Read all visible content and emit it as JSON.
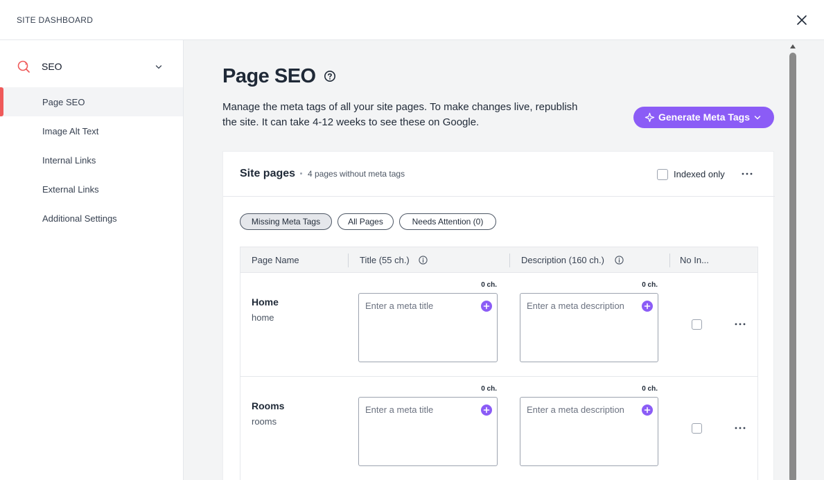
{
  "topbar": {
    "title": "SITE DASHBOARD"
  },
  "sidebar": {
    "section_label": "SEO",
    "items": [
      {
        "label": "Page SEO",
        "active": true
      },
      {
        "label": "Image Alt Text",
        "active": false
      },
      {
        "label": "Internal Links",
        "active": false
      },
      {
        "label": "External Links",
        "active": false
      },
      {
        "label": "Additional Settings",
        "active": false
      }
    ]
  },
  "main": {
    "title": "Page SEO",
    "description": "Manage the meta tags of all your site pages. To make changes live, republish the site. It can take 4-12 weeks to see these on Google.",
    "generate_button": "Generate Meta Tags",
    "card": {
      "title": "Site pages",
      "subtitle": "4 pages without meta tags",
      "indexed_only_label": "Indexed only",
      "filters": [
        {
          "label": "Missing Meta Tags",
          "active": true
        },
        {
          "label": "All Pages",
          "active": false
        },
        {
          "label": "Needs Attention (0)",
          "active": false
        }
      ],
      "table": {
        "headers": {
          "page_name": "Page Name",
          "title": "Title (55 ch.)",
          "description": "Description (160 ch.)",
          "no_index": "No In..."
        },
        "title_placeholder": "Enter a meta title",
        "description_placeholder": "Enter a meta description",
        "rows": [
          {
            "name": "Home",
            "slug": "home",
            "title_count": "0 ch.",
            "description_count": "0 ch."
          },
          {
            "name": "Rooms",
            "slug": "rooms",
            "title_count": "0 ch.",
            "description_count": "0 ch."
          }
        ]
      }
    }
  },
  "colors": {
    "accent": "#8b5cf6",
    "active_indicator": "#ef5a5a",
    "main_background": "#f3f4f5"
  }
}
